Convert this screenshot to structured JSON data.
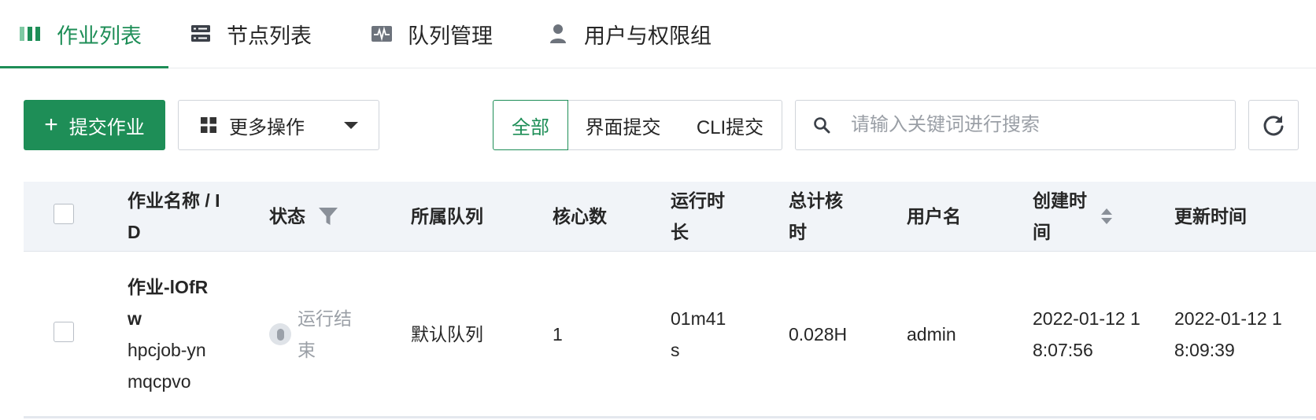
{
  "tabs": [
    {
      "label": "作业列表",
      "icon": "bars-icon",
      "active": true
    },
    {
      "label": "节点列表",
      "icon": "server-icon",
      "active": false
    },
    {
      "label": "队列管理",
      "icon": "monitor-wave-icon",
      "active": false
    },
    {
      "label": "用户与权限组",
      "icon": "user-icon",
      "active": false
    }
  ],
  "toolbar": {
    "submit_label": "提交作业",
    "more_label": "更多操作",
    "filters": [
      "全部",
      "界面提交",
      "CLI提交"
    ],
    "active_filter": "全部",
    "search_placeholder": "请输入关键词进行搜索",
    "search_value": ""
  },
  "table": {
    "columns": {
      "name": "作业名称 / ID",
      "status": "状态",
      "queue": "所属队列",
      "cores": "核心数",
      "runtime": "运行时长",
      "core_hours": "总计核时",
      "user": "用户名",
      "created": "创建时间",
      "updated": "更新时间"
    },
    "rows": [
      {
        "name": "作业-lOfRw",
        "id": "hpcjob-ynmqcpvo",
        "status": "运行结束",
        "queue": "默认队列",
        "cores": "1",
        "runtime": "01m41s",
        "core_hours": "0.028H",
        "user": "admin",
        "created": "2022-01-12 18:07:56",
        "updated": "2022-01-12 18:09:39"
      }
    ]
  },
  "colors": {
    "accent": "#1e8e57",
    "header_bg": "#f1f4f8",
    "border": "#d0d4da"
  }
}
